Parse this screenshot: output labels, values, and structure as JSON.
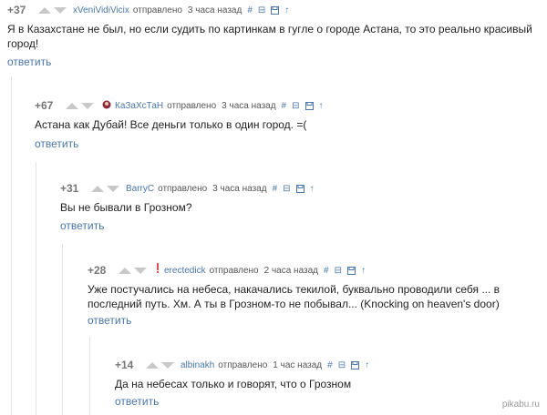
{
  "comments": [
    {
      "rating": "+37",
      "user": "xVeniVidiVicix",
      "sent": "отправлено",
      "time": "3 часа назад",
      "text": "Я в Казахстане не был, но если судить по картинкам в гугле о городе Астана, то это реально красивый город!",
      "reply": "ответить"
    },
    {
      "rating": "+67",
      "user": "КаЗаХсТаН",
      "sent": "отправлено",
      "time": "3 часа назад",
      "text": "Астана как Дубай! Все деньги только в один город. =(",
      "reply": "ответить"
    },
    {
      "rating": "+31",
      "user": "BarryC",
      "sent": "отправлено",
      "time": "3 часа назад",
      "text": "Вы не бывали в Грозном?",
      "reply": "ответить"
    },
    {
      "rating": "+28",
      "user": "erectedick",
      "sent": "отправлено",
      "time": "2 часа назад",
      "text": "Уже постучались на небеса, накачались текилой, буквально проводили себя ... в последний путь. Хм. А ты в Грозном-то не побывал... (Knocking on heaven's door)",
      "reply": "ответить"
    },
    {
      "rating": "+14",
      "user": "albinakh",
      "sent": "отправлено",
      "time": "1 час назад",
      "text": "Да на небесах только и говорят, что о Грозном",
      "reply": "ответить"
    }
  ],
  "tools": {
    "link": "#",
    "collapse": "⊟",
    "save": "save-icon",
    "up": "↑"
  },
  "watermark": "pikabu.ru",
  "colors": {
    "accent": "#4a76a8",
    "rating": "#777777",
    "arrow": "#c8c8c8"
  }
}
